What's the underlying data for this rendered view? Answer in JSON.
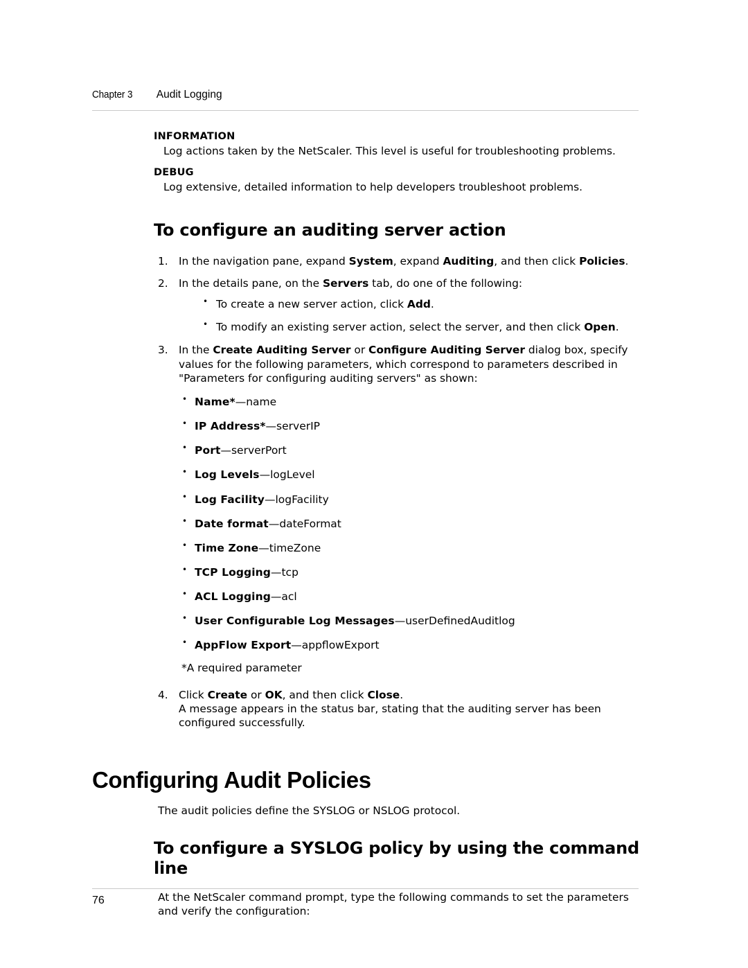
{
  "header": {
    "chapter_label": "Chapter 3",
    "chapter_title": "Audit Logging"
  },
  "footer": {
    "page_number": "76"
  },
  "log_levels": [
    {
      "term": "INFORMATION",
      "description": "Log actions taken by the NetScaler. This level is useful for troubleshooting problems."
    },
    {
      "term": "DEBUG",
      "description": "Log extensive, detailed information to help developers troubleshoot problems."
    }
  ],
  "procedure": {
    "heading": "To configure an auditing server action",
    "step1": {
      "number": "1.",
      "t1": "In the navigation pane, expand ",
      "b1": "System",
      "t2": ", expand ",
      "b2": "Auditing",
      "t3": ", and then click ",
      "b3": "Policies",
      "t4": "."
    },
    "step2": {
      "number": "2.",
      "t1": "In the details pane, on the ",
      "b1": "Servers",
      "t2": " tab, do one of the following:",
      "bullets": [
        {
          "t1": "To create a new server action, click ",
          "b1": "Add",
          "t2": "."
        },
        {
          "t1": "To modify an existing server action, select the server, and then click ",
          "b1": "Open",
          "t2": "."
        }
      ]
    },
    "step3": {
      "number": "3.",
      "t1": "In the ",
      "b1": "Create Auditing Server",
      "t2": " or ",
      "b2": "Configure Auditing Server",
      "t3": " dialog box, specify values for the following parameters, which correspond to parameters described in \"Parameters for configuring auditing servers\" as shown:"
    },
    "parameters": [
      {
        "name": "Name*",
        "value": "—name"
      },
      {
        "name": "IP Address*",
        "value": "—serverIP"
      },
      {
        "name": "Port",
        "value": "—serverPort"
      },
      {
        "name": "Log Levels",
        "value": "—logLevel"
      },
      {
        "name": "Log Facility",
        "value": "—logFacility"
      },
      {
        "name": "Date format",
        "value": "—dateFormat"
      },
      {
        "name": "Time Zone",
        "value": "—timeZone"
      },
      {
        "name": "TCP Logging",
        "value": "—tcp"
      },
      {
        "name": "ACL Logging",
        "value": "—acl"
      },
      {
        "name": "User Configurable Log Messages",
        "value": "—userDefinedAuditlog"
      },
      {
        "name": "AppFlow Export",
        "value": "—appflowExport"
      }
    ],
    "footnote": "*A required parameter",
    "step4": {
      "number": "4.",
      "t1": "Click ",
      "b1": "Create",
      "t2": " or ",
      "b2": "OK",
      "t3": ", and then click ",
      "b3": "Close",
      "t4": ".",
      "followup": "A message appears in the status bar, stating that the auditing server has been configured successfully."
    }
  },
  "section": {
    "heading": "Configuring Audit Policies",
    "intro": "The audit policies define the SYSLOG or NSLOG protocol.",
    "subheading": "To configure a SYSLOG policy by using the command line",
    "paragraph": "At the NetScaler command prompt, type the following commands to set the parameters and verify the configuration:"
  }
}
